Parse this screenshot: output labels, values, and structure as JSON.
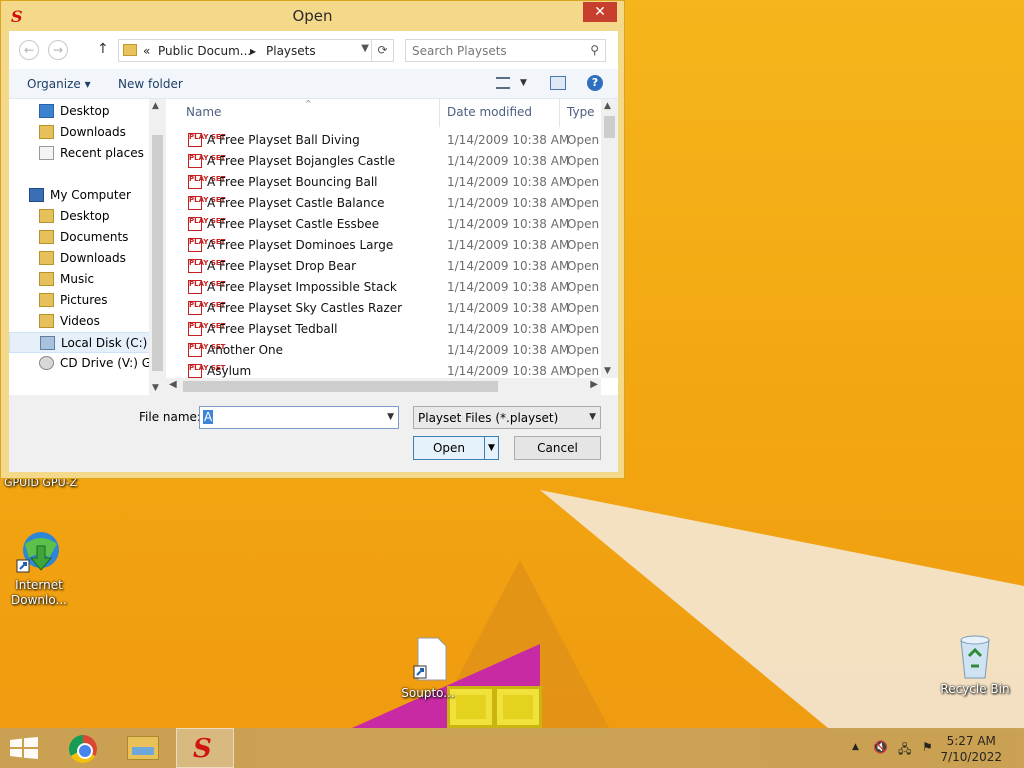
{
  "dialog": {
    "title": "Open",
    "close_glyph": "✕",
    "app_icon_letter": "S"
  },
  "navbar": {
    "back_glyph": "←",
    "forward_glyph": "→",
    "up_glyph": "↑",
    "breadcrumb": [
      "«",
      "Public Docum...",
      "▸",
      "Playsets"
    ],
    "search_placeholder": "Search Playsets"
  },
  "toolbar": {
    "organize": "Organize ▾",
    "new_folder": "New folder",
    "help": "?"
  },
  "nav_items": [
    {
      "label": "Desktop",
      "icon": "desktop-icon",
      "kind": "fold blue"
    },
    {
      "label": "Downloads",
      "icon": "downloads-folder-icon",
      "kind": "fold"
    },
    {
      "label": "Recent places",
      "icon": "recent-places-icon",
      "kind": "doc"
    },
    {
      "label": "My Computer",
      "icon": "computer-icon",
      "kind": "pc"
    },
    {
      "label": "Desktop",
      "icon": "folder-icon",
      "kind": "fold"
    },
    {
      "label": "Documents",
      "icon": "folder-icon",
      "kind": "fold"
    },
    {
      "label": "Downloads",
      "icon": "folder-icon",
      "kind": "fold"
    },
    {
      "label": "Music",
      "icon": "folder-icon",
      "kind": "music"
    },
    {
      "label": "Pictures",
      "icon": "folder-icon",
      "kind": "fold"
    },
    {
      "label": "Videos",
      "icon": "folder-icon",
      "kind": "fold"
    },
    {
      "label": "Local Disk (C:)",
      "icon": "hard-disk-icon",
      "kind": "disk",
      "selected": true
    },
    {
      "label": "CD Drive (V:) GSP",
      "icon": "cd-drive-icon",
      "kind": "cd"
    }
  ],
  "columns": {
    "name": "Name",
    "date": "Date modified",
    "type": "Type"
  },
  "files": [
    {
      "name": "A Free Playset Ball Diving",
      "date": "1/14/2009 10:38 AM",
      "type": "Open I"
    },
    {
      "name": "A Free Playset Bojangles Castle",
      "date": "1/14/2009 10:38 AM",
      "type": "Open I"
    },
    {
      "name": "A Free Playset Bouncing Ball",
      "date": "1/14/2009 10:38 AM",
      "type": "Open I"
    },
    {
      "name": "A Free Playset Castle Balance",
      "date": "1/14/2009 10:38 AM",
      "type": "Open I"
    },
    {
      "name": "A Free Playset Castle Essbee",
      "date": "1/14/2009 10:38 AM",
      "type": "Open I"
    },
    {
      "name": "A Free Playset Dominoes Large",
      "date": "1/14/2009 10:38 AM",
      "type": "Open I"
    },
    {
      "name": "A Free Playset Drop Bear",
      "date": "1/14/2009 10:38 AM",
      "type": "Open I"
    },
    {
      "name": "A Free Playset Impossible Stack",
      "date": "1/14/2009 10:38 AM",
      "type": "Open I"
    },
    {
      "name": "A Free Playset Sky Castles Razer",
      "date": "1/14/2009 10:38 AM",
      "type": "Open I"
    },
    {
      "name": "A Free Playset Tedball",
      "date": "1/14/2009 10:38 AM",
      "type": "Open I"
    },
    {
      "name": "Another One",
      "date": "1/14/2009 10:38 AM",
      "type": "Open I"
    },
    {
      "name": "Asylum",
      "date": "1/14/2009 10:38 AM",
      "type": "Open I"
    }
  ],
  "file_icon_text": "PLAY SET",
  "footer": {
    "file_name_label": "File name:",
    "file_name_value": "A",
    "file_type": "Playset Files (*.playset)",
    "open_label": "Open",
    "cancel_label": "Cancel"
  },
  "desktop": {
    "gpuid_label": "GPUID GPU-Z",
    "icons": [
      {
        "label": "Internet Downlo...",
        "name": "internet-download-manager-icon"
      },
      {
        "label": "Soupto...",
        "name": "soupto-shortcut-icon"
      },
      {
        "label": "Recycle Bin",
        "name": "recycle-bin-icon"
      }
    ]
  },
  "taskbar": {
    "time": "5:27 AM",
    "date": "7/10/2022",
    "tray_glyphs": [
      "▲",
      "🔇",
      "🖧",
      "⚑"
    ]
  },
  "colors": {
    "desktop_bg": "#f2a611",
    "dialog_frame": "#f5d98a",
    "close_red": "#c7402d",
    "taskbar": "#c9a256"
  }
}
